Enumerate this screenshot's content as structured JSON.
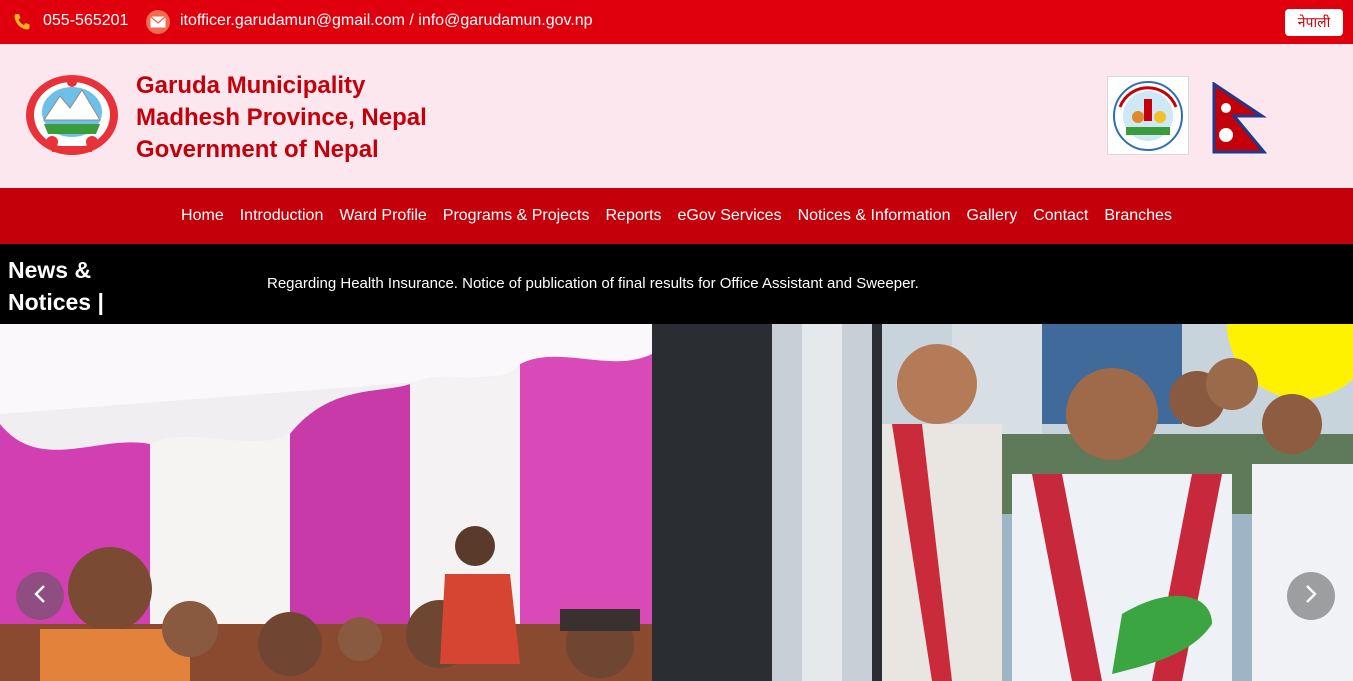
{
  "topbar": {
    "phone": "055-565201",
    "email": "itofficer.garudamun@gmail.com / info@garudamun.gov.np",
    "language_button": "नेपाली"
  },
  "header": {
    "line1": "Garuda Municipality",
    "line2": "Madhesh Province, Nepal",
    "line3": "Government of Nepal"
  },
  "nav": {
    "items": [
      "Home",
      "Introduction",
      "Ward Profile",
      "Programs & Projects",
      "Reports",
      "eGov Services",
      "Notices & Information",
      "Gallery",
      "Contact",
      "Branches"
    ]
  },
  "ticker": {
    "title_line1": "News &",
    "title_line2": "Notices |",
    "text": "Regarding Health Insurance. Notice of publication of final results for Office Assistant and Sweeper."
  },
  "colors": {
    "topbar": "#e0000d",
    "header_bg": "#fde7ef",
    "brand_red": "#c4000a",
    "ticker_bg": "#000000"
  },
  "icons": {
    "phone": "phone-icon",
    "mail": "mail-icon",
    "prev": "chevron-left-icon",
    "next": "chevron-right-icon"
  }
}
